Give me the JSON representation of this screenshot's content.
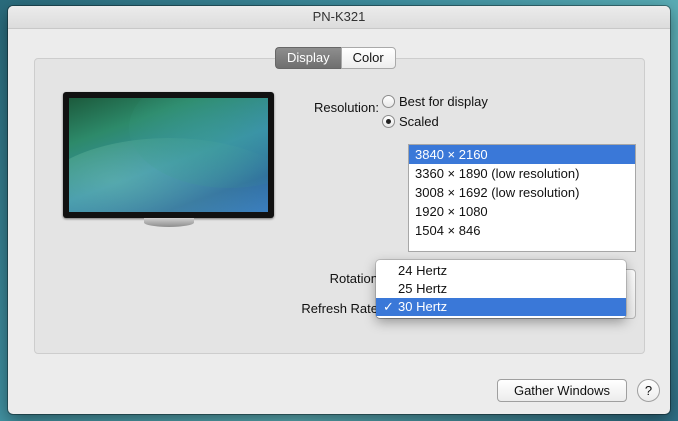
{
  "window": {
    "title": "PN-K321"
  },
  "tabs": [
    {
      "label": "Display",
      "active": true
    },
    {
      "label": "Color",
      "active": false
    }
  ],
  "resolution": {
    "label": "Resolution:",
    "options": [
      {
        "label": "Best for display",
        "selected": false
      },
      {
        "label": "Scaled",
        "selected": true
      }
    ],
    "scaled_list": [
      {
        "label": "3840 × 2160",
        "selected": true
      },
      {
        "label": "3360 × 1890 (low resolution)",
        "selected": false
      },
      {
        "label": "3008 × 1692 (low resolution)",
        "selected": false
      },
      {
        "label": "1920 × 1080",
        "selected": false
      },
      {
        "label": "1504 × 846",
        "selected": false
      }
    ]
  },
  "rotation": {
    "label": "Rotation"
  },
  "refresh_rate": {
    "label": "Refresh Rate",
    "options": [
      {
        "label": "24 Hertz",
        "selected": false
      },
      {
        "label": "25 Hertz",
        "selected": false
      },
      {
        "label": "30 Hertz",
        "selected": true
      }
    ]
  },
  "buttons": {
    "gather": "Gather Windows",
    "help": "?"
  },
  "icons": {
    "checkmark": "✓"
  },
  "colors": {
    "selection": "#3a78d8",
    "active_tab": "#7a7a7a"
  }
}
